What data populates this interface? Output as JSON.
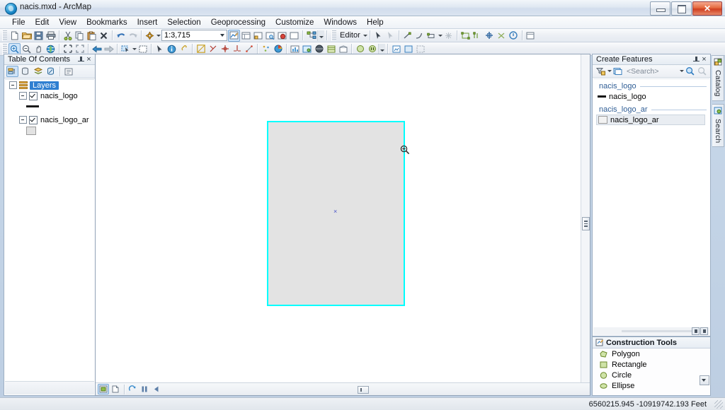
{
  "window": {
    "title": "nacis.mxd - ArcMap",
    "app_icon": "arcmap-globe-icon",
    "minimize_label": "–",
    "maximize_label": "□",
    "close_label": "✕"
  },
  "menu": {
    "items": [
      {
        "label": "File"
      },
      {
        "label": "Edit"
      },
      {
        "label": "View"
      },
      {
        "label": "Bookmarks"
      },
      {
        "label": "Insert"
      },
      {
        "label": "Selection"
      },
      {
        "label": "Geoprocessing"
      },
      {
        "label": "Customize"
      },
      {
        "label": "Windows"
      },
      {
        "label": "Help"
      }
    ]
  },
  "standard_toolbar": {
    "scale_value": "1:3,715",
    "buttons": [
      {
        "name": "new-map-icon"
      },
      {
        "name": "open-icon"
      },
      {
        "name": "save-icon"
      },
      {
        "name": "print-icon"
      },
      {
        "name": "cut-icon"
      },
      {
        "name": "copy-icon"
      },
      {
        "name": "paste-icon"
      },
      {
        "name": "delete-icon"
      },
      {
        "name": "undo-icon"
      },
      {
        "name": "redo-icon"
      },
      {
        "name": "add-data-icon"
      }
    ],
    "right_buttons": [
      {
        "name": "editor-toolbar-icon"
      },
      {
        "name": "table-of-contents-icon"
      },
      {
        "name": "catalog-window-icon"
      },
      {
        "name": "search-window-icon"
      },
      {
        "name": "arcglobe-icon"
      },
      {
        "name": "python-window-icon"
      },
      {
        "name": "model-builder-icon"
      }
    ]
  },
  "editor_toolbar": {
    "menu_label": "Editor",
    "buttons": [
      {
        "name": "edit-tool-icon"
      },
      {
        "name": "edit-annotation-icon"
      },
      {
        "name": "straight-segment-icon"
      },
      {
        "name": "curve-segment-icon"
      },
      {
        "name": "trace-icon"
      },
      {
        "name": "point-icon"
      },
      {
        "name": "split-icon"
      },
      {
        "name": "rotate-icon"
      },
      {
        "name": "attributes-icon"
      },
      {
        "name": "sketch-properties-icon"
      },
      {
        "name": "create-features-icon"
      }
    ]
  },
  "tools_toolbar": {
    "buttons": [
      {
        "name": "zoom-in-icon"
      },
      {
        "name": "zoom-out-icon"
      },
      {
        "name": "pan-icon"
      },
      {
        "name": "full-extent-icon"
      },
      {
        "name": "fixed-zoom-in-icon"
      },
      {
        "name": "fixed-zoom-out-icon"
      },
      {
        "name": "go-back-extent-icon"
      },
      {
        "name": "go-forward-extent-icon"
      },
      {
        "name": "select-features-icon"
      },
      {
        "name": "clear-selection-icon"
      },
      {
        "name": "select-elements-icon"
      },
      {
        "name": "identify-icon"
      }
    ]
  },
  "toc": {
    "title": "Table Of Contents",
    "tabs": [
      {
        "name": "list-by-drawing-order-icon"
      },
      {
        "name": "list-by-source-icon"
      },
      {
        "name": "list-by-visibility-icon"
      },
      {
        "name": "list-by-selection-icon"
      },
      {
        "name": "options-icon"
      }
    ],
    "root": "Layers",
    "layers": [
      {
        "label": "nacis_logo",
        "checked": true,
        "symbol": "line"
      },
      {
        "label": "nacis_logo_ar",
        "checked": true,
        "symbol": "polygon"
      }
    ]
  },
  "create_features": {
    "title": "Create Features",
    "search_placeholder": "<Search>",
    "groups": [
      {
        "header": "nacis_logo",
        "templates": [
          {
            "label": "nacis_logo",
            "symbol": "line",
            "selected": false
          }
        ]
      },
      {
        "header": "nacis_logo_ar",
        "templates": [
          {
            "label": "nacis_logo_ar",
            "symbol": "polygon",
            "selected": true
          }
        ]
      }
    ]
  },
  "construction_tools": {
    "title": "Construction Tools",
    "items": [
      {
        "label": "Polygon",
        "icon": "polygon-tool-icon"
      },
      {
        "label": "Rectangle",
        "icon": "rectangle-tool-icon"
      },
      {
        "label": "Circle",
        "icon": "circle-tool-icon"
      },
      {
        "label": "Ellipse",
        "icon": "ellipse-tool-icon"
      }
    ]
  },
  "side_tabs": [
    {
      "label": "Catalog",
      "icon": "catalog-icon"
    },
    {
      "label": "Search",
      "icon": "search-icon"
    }
  ],
  "map": {
    "cursor": "zoom-magnifier-cursor",
    "selected_feature": {
      "name": "selected-polygon",
      "outline_color": "#00ffff",
      "fill_color": "#e3e3e3"
    },
    "center_marker": "×",
    "footer_buttons": [
      {
        "name": "data-view-icon"
      },
      {
        "name": "layout-view-icon"
      },
      {
        "name": "refresh-icon"
      },
      {
        "name": "pause-drawing-icon"
      },
      {
        "name": "previous-view-icon"
      }
    ]
  },
  "status_bar": {
    "coordinates": "6560215.945  -10919742.193 Feet"
  }
}
